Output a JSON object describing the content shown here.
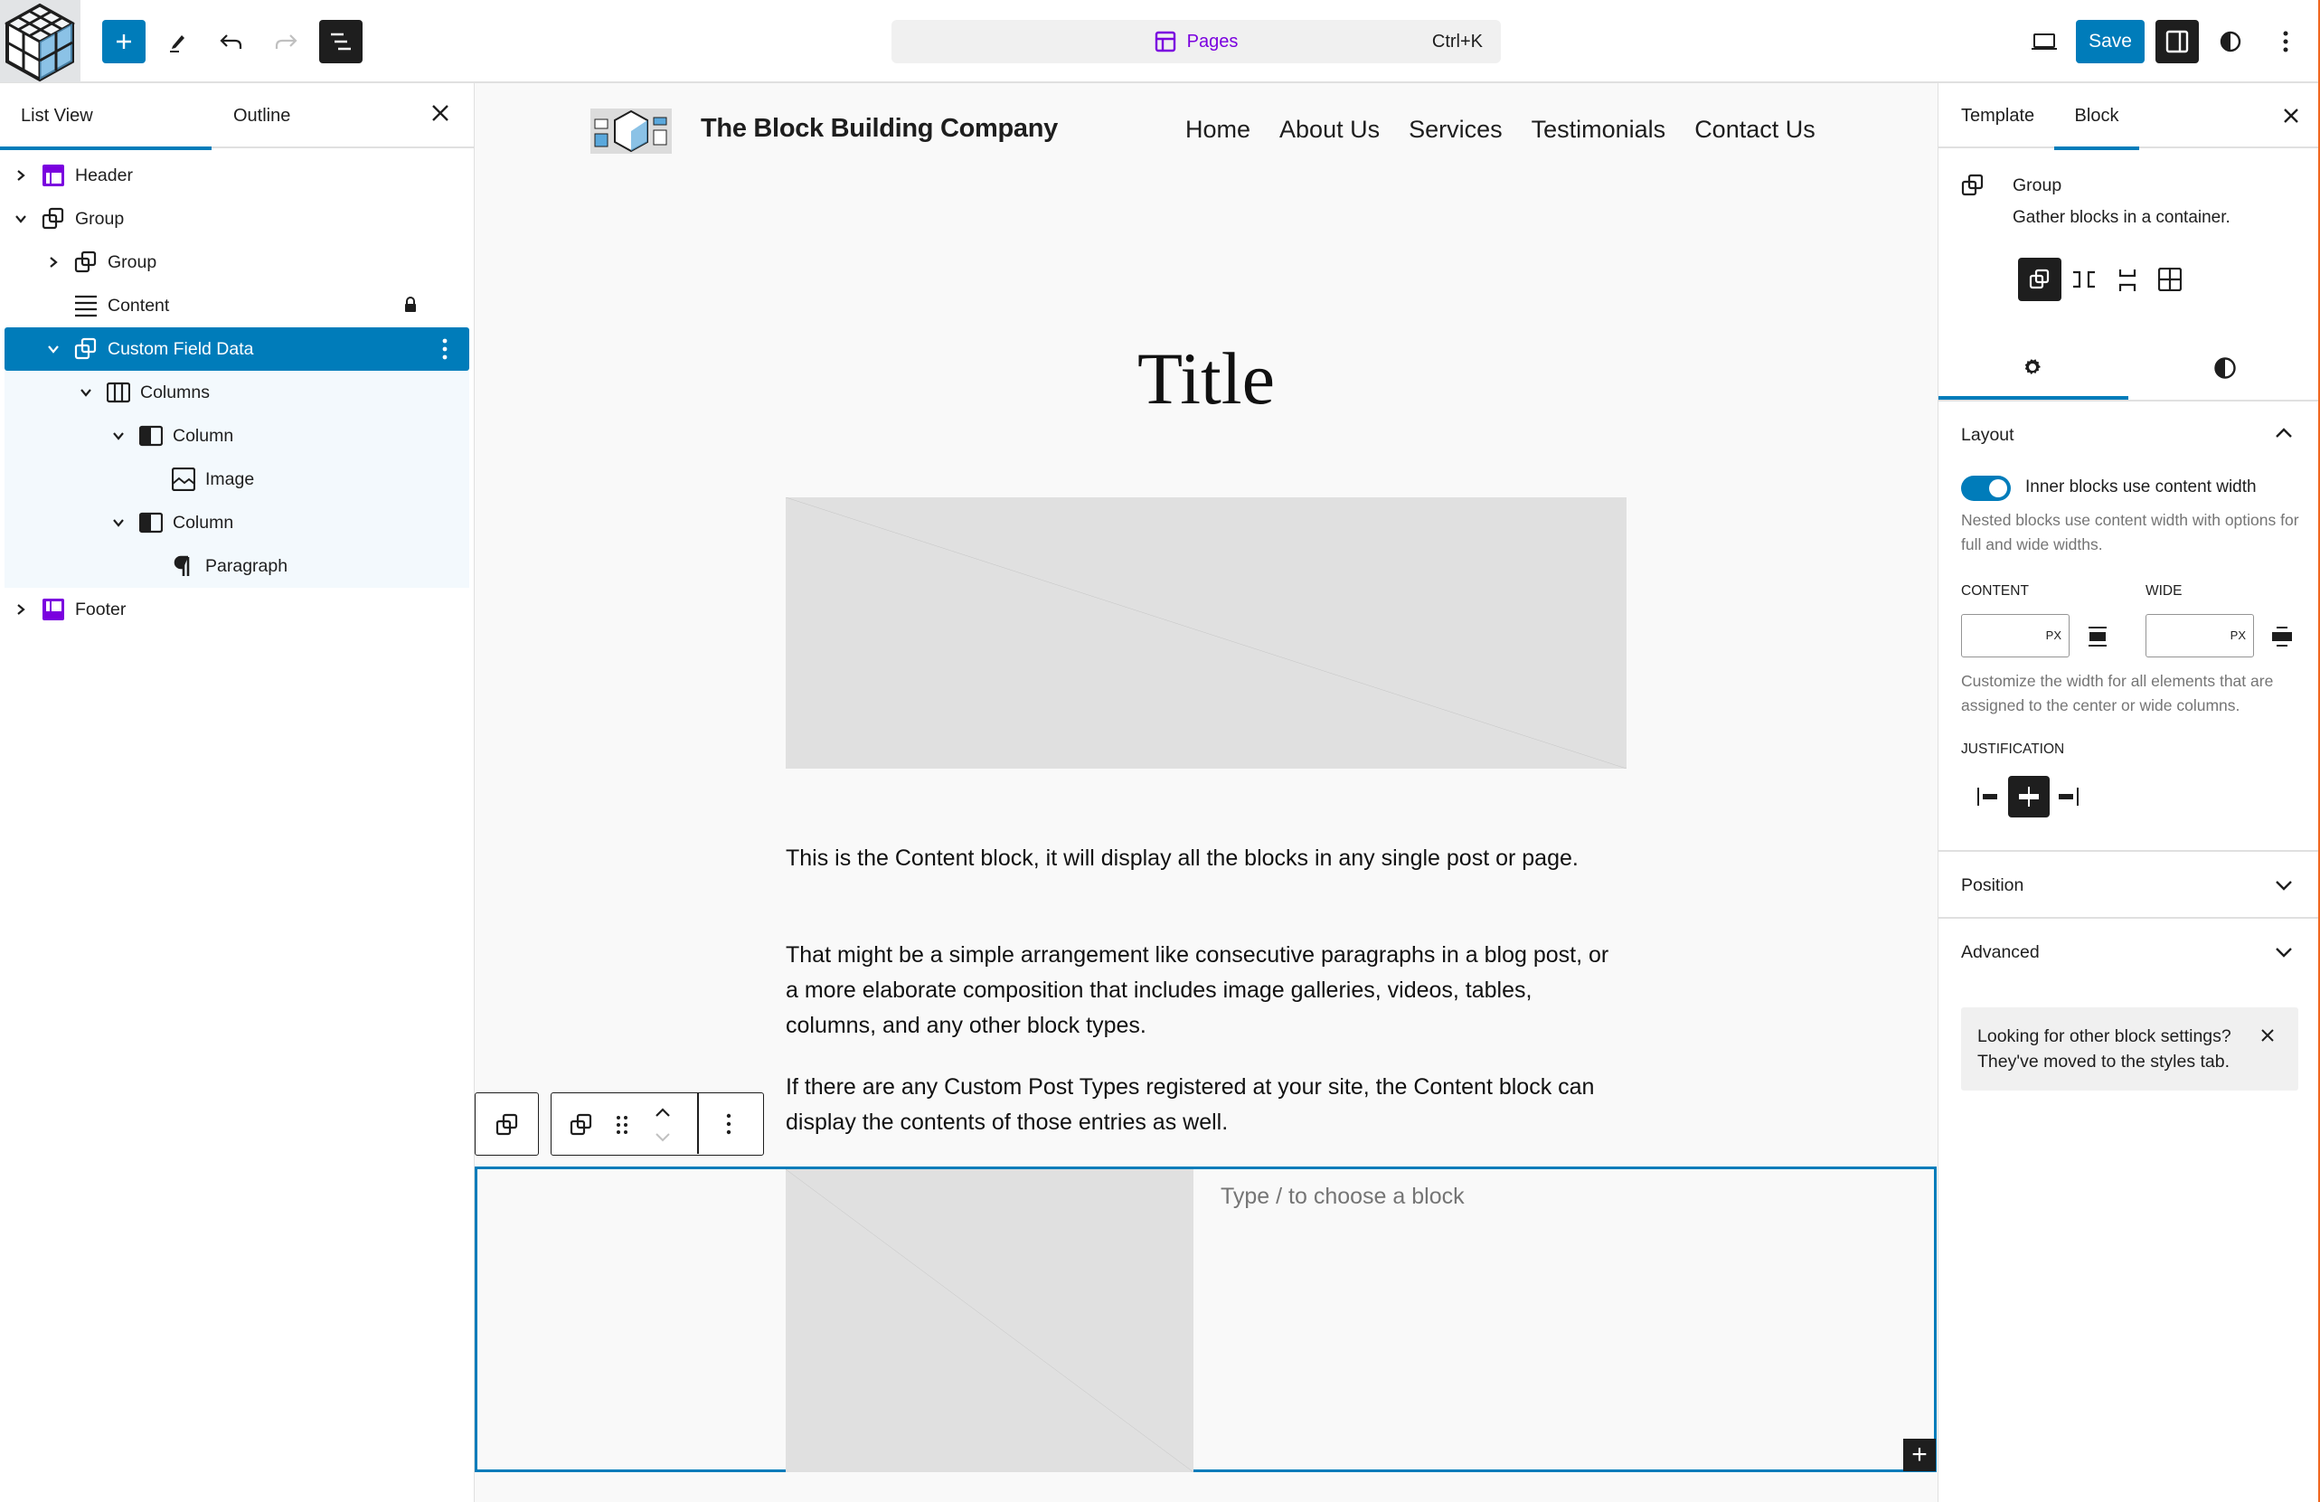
{
  "topbar": {
    "add_block_label": "Add block",
    "tools_label": "Tools",
    "undo_label": "Undo",
    "redo_label": "Redo",
    "document_overview_label": "Document Overview",
    "command_palette": {
      "label": "Pages",
      "shortcut": "Ctrl+K"
    },
    "view_label": "View",
    "save_label": "Save",
    "settings_label": "Settings",
    "styles_label": "Styles",
    "options_label": "Options"
  },
  "left_panel": {
    "tabs": [
      {
        "label": "List View",
        "active": true
      },
      {
        "label": "Outline",
        "active": false
      }
    ],
    "close_label": "Close",
    "items": [
      {
        "label": "Header",
        "icon": "template-part-header-icon",
        "depth": 0,
        "expander": "collapsed"
      },
      {
        "label": "Group",
        "icon": "group-icon",
        "depth": 0,
        "expander": "expanded"
      },
      {
        "label": "Group",
        "icon": "group-icon",
        "depth": 1,
        "expander": "collapsed"
      },
      {
        "label": "Content",
        "icon": "post-content-icon",
        "depth": 1,
        "expander": "none",
        "locked": true
      },
      {
        "label": "Custom Field Data",
        "icon": "group-icon",
        "depth": 1,
        "expander": "expanded",
        "selected": true
      },
      {
        "label": "Columns",
        "icon": "columns-icon",
        "depth": 2,
        "expander": "expanded"
      },
      {
        "label": "Column",
        "icon": "column-icon",
        "depth": 3,
        "expander": "expanded"
      },
      {
        "label": "Image",
        "icon": "image-icon",
        "depth": 4,
        "expander": "none"
      },
      {
        "label": "Column",
        "icon": "column-icon",
        "depth": 3,
        "expander": "expanded"
      },
      {
        "label": "Paragraph",
        "icon": "paragraph-icon",
        "depth": 4,
        "expander": "none"
      },
      {
        "label": "Footer",
        "icon": "template-part-footer-icon",
        "depth": 0,
        "expander": "collapsed"
      }
    ]
  },
  "canvas": {
    "site_title": "The Block Building Company",
    "nav": [
      "Home",
      "About Us",
      "Services",
      "Testimonials",
      "Contact Us"
    ],
    "page_title": "Title",
    "paragraphs": [
      "This is the Content block, it will display all the blocks in any single post or page.",
      "That might be a simple arrangement like consecutive paragraphs in a blog post, or a more elaborate composition that includes image galleries, videos, tables, columns, and any other block types.",
      "If there are any Custom Post Types registered at your site, the Content block can display the contents of those entries as well."
    ],
    "block_placeholder": "Type / to choose a block",
    "appender_label": "+"
  },
  "right_panel": {
    "tabs": [
      {
        "label": "Template",
        "active": false
      },
      {
        "label": "Block",
        "active": true
      }
    ],
    "block": {
      "name": "Group",
      "description": "Gather blocks in a container."
    },
    "variations": [
      "Group",
      "Row",
      "Stack",
      "Grid"
    ],
    "settings_tabs": [
      "Settings",
      "Styles"
    ],
    "layout": {
      "title": "Layout",
      "toggle_label": "Inner blocks use content width",
      "toggle_on": true,
      "toggle_help": "Nested blocks use content width with options for full and wide widths.",
      "content_label": "CONTENT",
      "content_value": "",
      "wide_label": "WIDE",
      "wide_value": "",
      "unit": "PX",
      "width_help": "Customize the width for all elements that are assigned to the center or wide columns.",
      "justification_label": "JUSTIFICATION",
      "justification_options": [
        "left",
        "center",
        "right"
      ],
      "justification_selected": "center"
    },
    "panels": [
      {
        "title": "Position"
      },
      {
        "title": "Advanced"
      }
    ],
    "notice": "Looking for other block settings? They've moved to the styles tab."
  },
  "colors": {
    "accent": "#007cba",
    "template_part": "#7a00df",
    "dark": "#1e1e1e"
  }
}
